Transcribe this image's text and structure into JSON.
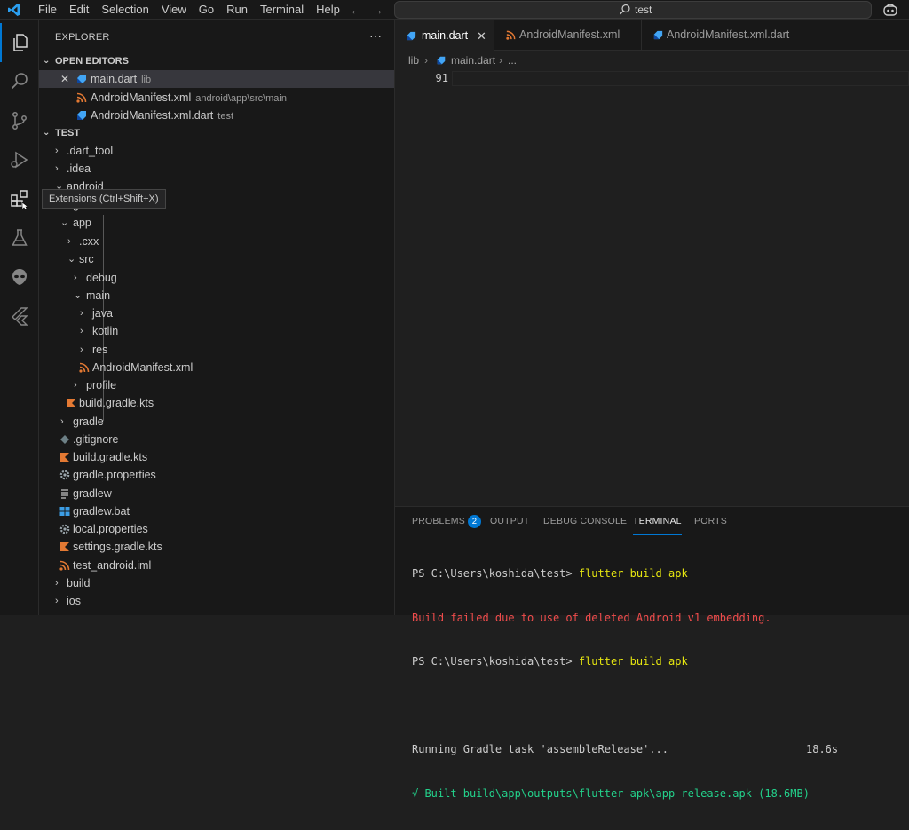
{
  "menu": [
    "File",
    "Edit",
    "Selection",
    "View",
    "Go",
    "Run",
    "Terminal",
    "Help"
  ],
  "search": {
    "text": "test"
  },
  "tooltip": "Extensions (Ctrl+Shift+X)",
  "explorer": {
    "title": "EXPLORER",
    "more": "···",
    "open_editors_label": "OPEN EDITORS",
    "open_editors": [
      {
        "name": "main.dart",
        "desc": "lib"
      },
      {
        "name": "AndroidManifest.xml",
        "desc": "android\\app\\src\\main"
      },
      {
        "name": "AndroidManifest.xml.dart",
        "desc": "test"
      }
    ],
    "folder_label": "TEST",
    "tree": [
      ".dart_tool",
      ".idea",
      "android",
      "gradle",
      "app",
      ".cxx",
      "src",
      "debug",
      "main",
      "java",
      "kotlin",
      "res",
      "AndroidManifest.xml",
      "profile",
      "build.gradle.kts",
      "gradle",
      ".gitignore",
      "build.gradle.kts",
      "gradle.properties",
      "gradlew",
      "gradlew.bat",
      "local.properties",
      "settings.gradle.kts",
      "test_android.iml",
      "build",
      "ios"
    ]
  },
  "tabs": [
    {
      "name": "main.dart",
      "close": "✕"
    },
    {
      "name": "AndroidManifest.xml"
    },
    {
      "name": "AndroidManifest.xml.dart"
    }
  ],
  "breadcrumb": {
    "folder": "lib",
    "file": "main.dart",
    "more": "..."
  },
  "editor": {
    "line_number": "91"
  },
  "panel": {
    "tabs": [
      "PROBLEMS",
      "OUTPUT",
      "DEBUG CONSOLE",
      "TERMINAL",
      "PORTS"
    ],
    "problems_count": "2",
    "terminal": {
      "prompt1": "PS C:\\Users\\koshida\\test> ",
      "cmd1": "flutter build apk",
      "error": "Build failed due to use of deleted Android v1 embedding.",
      "prompt2": "PS C:\\Users\\koshida\\test> ",
      "cmd2": "flutter build apk",
      "gradle": "Running Gradle task 'assembleRelease'...",
      "gradle_time": "18.6s",
      "built": "√ Built build\\app\\outputs\\flutter-apk\\app-release.apk (18.6MB)"
    }
  },
  "colors": {
    "accent": "#0078d4",
    "xml": "#e37933",
    "dart": "#42a5f5",
    "kotlin": "#e44857",
    "error": "#f14c4c",
    "command": "#e5e510"
  }
}
